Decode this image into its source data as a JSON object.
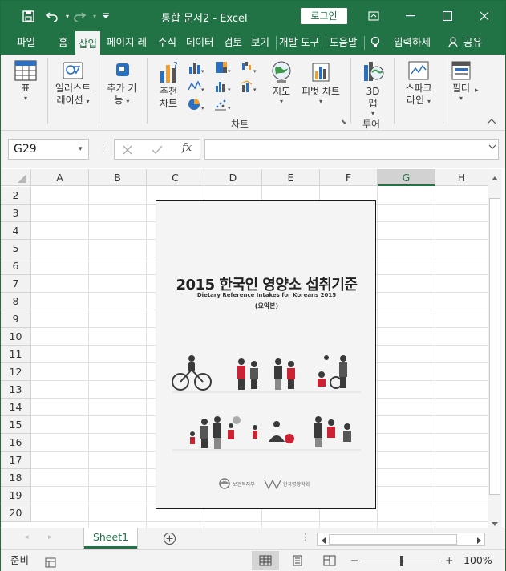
{
  "titlebar": {
    "save_icon": "save-icon",
    "undo_icon": "undo-icon",
    "redo_icon": "redo-icon",
    "customize_icon": "chevron-down-icon",
    "title": "통합 문서2  -  Excel",
    "login_label": "로그인",
    "ribbon_display_icon": "ribbon-display-icon",
    "minimize_icon": "minimize-icon",
    "maximize_icon": "maximize-icon",
    "close_icon": "close-icon"
  },
  "tabs": [
    {
      "label": "파일"
    },
    {
      "label": "홈"
    },
    {
      "label": "삽입"
    },
    {
      "label": "페이지 레"
    },
    {
      "label": "수식"
    },
    {
      "label": "데이터"
    },
    {
      "label": "검토"
    },
    {
      "label": "보기"
    },
    {
      "label": "개발 도구"
    },
    {
      "label": "도움말"
    },
    {
      "label": "입력하세"
    },
    {
      "label": "공유"
    }
  ],
  "ribbon": {
    "table_label": "표",
    "illustrations_label_1": "일러스트",
    "illustrations_label_2": "레이션",
    "addins_label_1": "추가 기",
    "addins_label_2": "능",
    "recommended_charts_1": "추천",
    "recommended_charts_2": "차트",
    "maps_label": "지도",
    "pivot_chart_label": "피벗 차트",
    "map3d_label_1": "3D",
    "map3d_label_2": "맵",
    "sparklines_label_1": "스파크",
    "sparklines_label_2": "라인",
    "filter_label": "필터",
    "charts_group_label": "차트",
    "tours_group_label": "투어"
  },
  "formula_bar": {
    "name_box": "G29",
    "cancel_icon": "cancel-icon",
    "enter_icon": "check-icon",
    "fx_label": "fx",
    "formula_value": ""
  },
  "grid": {
    "columns": [
      "A",
      "B",
      "C",
      "D",
      "E",
      "F",
      "G",
      "H"
    ],
    "selected_column": "G",
    "rows": [
      "2",
      "3",
      "4",
      "5",
      "6",
      "7",
      "8",
      "9",
      "10",
      "11",
      "12",
      "13",
      "14",
      "15",
      "16",
      "17",
      "18",
      "19",
      "20"
    ]
  },
  "poster": {
    "title": "2015 한국인 영양소 섭취기준",
    "subtitle": "Dietary Reference Intakes for Koreans 2015",
    "edition": "(요약본)",
    "logo_left": "보건복지부",
    "logo_right": "한국영양학회"
  },
  "sheets": {
    "active": "Sheet1",
    "add_icon": "add-sheet-icon"
  },
  "status": {
    "ready": "준비",
    "zoom": "100%",
    "zoom_level": 0.5
  }
}
